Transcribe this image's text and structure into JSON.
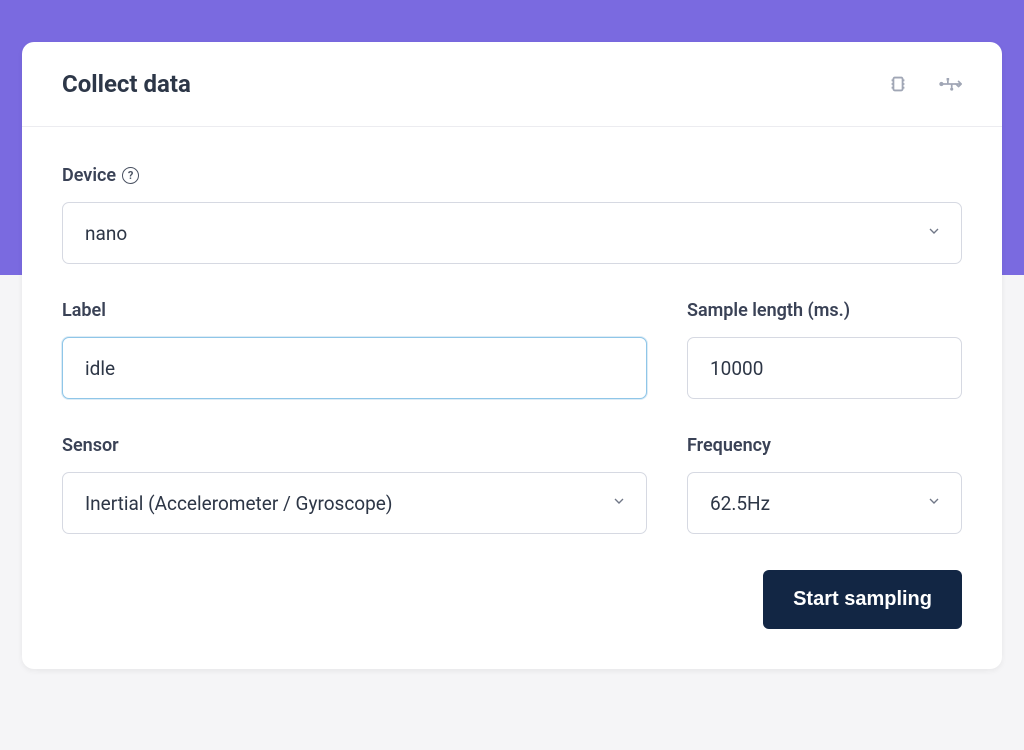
{
  "card": {
    "title": "Collect data",
    "icons": {
      "chip": "chip-icon",
      "usb": "usb-icon"
    }
  },
  "form": {
    "device": {
      "label": "Device",
      "value": "nano"
    },
    "label_field": {
      "label": "Label",
      "value": "idle"
    },
    "sample_length": {
      "label": "Sample length (ms.)",
      "value": "10000"
    },
    "sensor": {
      "label": "Sensor",
      "value": "Inertial (Accelerometer / Gyroscope)"
    },
    "frequency": {
      "label": "Frequency",
      "value": "62.5Hz"
    }
  },
  "actions": {
    "start_sampling": "Start sampling"
  }
}
